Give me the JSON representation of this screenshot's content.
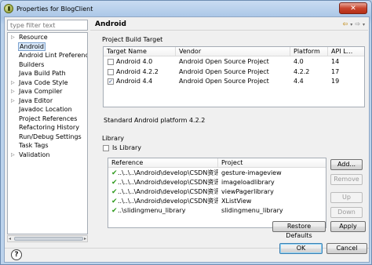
{
  "window": {
    "title": "Properties for BlogClient",
    "close_label": "✕"
  },
  "filter": {
    "placeholder": "type filter text"
  },
  "tree": [
    {
      "label": "Resource",
      "arrow": "▷"
    },
    {
      "label": "Android",
      "arrow": "",
      "selected": true
    },
    {
      "label": "Android Lint Preferences",
      "arrow": ""
    },
    {
      "label": "Builders",
      "arrow": ""
    },
    {
      "label": "Java Build Path",
      "arrow": ""
    },
    {
      "label": "Java Code Style",
      "arrow": "▷"
    },
    {
      "label": "Java Compiler",
      "arrow": "▷"
    },
    {
      "label": "Java Editor",
      "arrow": "▷"
    },
    {
      "label": "Javadoc Location",
      "arrow": ""
    },
    {
      "label": "Project References",
      "arrow": ""
    },
    {
      "label": "Refactoring History",
      "arrow": ""
    },
    {
      "label": "Run/Debug Settings",
      "arrow": ""
    },
    {
      "label": "Task Tags",
      "arrow": ""
    },
    {
      "label": "Validation",
      "arrow": "▷"
    }
  ],
  "pane": {
    "title": "Android",
    "back_icon": "⇦",
    "forward_icon": "⇨",
    "dropdown_icon": "▾"
  },
  "build_target": {
    "heading": "Project Build Target",
    "columns": [
      "Target Name",
      "Vendor",
      "Platform",
      "API L..."
    ],
    "rows": [
      {
        "name": "Android 4.0",
        "vendor": "Android Open Source Project",
        "platform": "4.0",
        "api": "14",
        "checked": false
      },
      {
        "name": "Android 4.2.2",
        "vendor": "Android Open Source Project",
        "platform": "4.2.2",
        "api": "17",
        "checked": false
      },
      {
        "name": "Android 4.4",
        "vendor": "Android Open Source Project",
        "platform": "4.4",
        "api": "19",
        "checked": true
      }
    ],
    "status": "Standard Android platform 4.2.2"
  },
  "library": {
    "heading": "Library",
    "is_library_label": "Is Library",
    "is_library_checked": false,
    "columns": [
      "Reference",
      "Project"
    ],
    "rows": [
      {
        "ref": "..\\..\\..\\Android\\develop\\CSDN资讯...",
        "project": "gesture-imageview"
      },
      {
        "ref": "..\\..\\..\\Android\\develop\\CSDN资讯...",
        "project": "imageloadlibrary"
      },
      {
        "ref": "..\\..\\..\\Android\\develop\\CSDN资讯...",
        "project": "viewPagerlibrary"
      },
      {
        "ref": "..\\..\\..\\Android\\develop\\CSDN资讯...",
        "project": "XListView"
      },
      {
        "ref": "..\\slidingmenu_library",
        "project": "slidingmenu_library"
      }
    ],
    "buttons": {
      "add": "Add...",
      "remove": "Remove",
      "up": "Up",
      "down": "Down"
    }
  },
  "footer": {
    "restore": "Restore Defaults",
    "apply": "Apply",
    "ok": "OK",
    "cancel": "Cancel",
    "help": "?"
  }
}
